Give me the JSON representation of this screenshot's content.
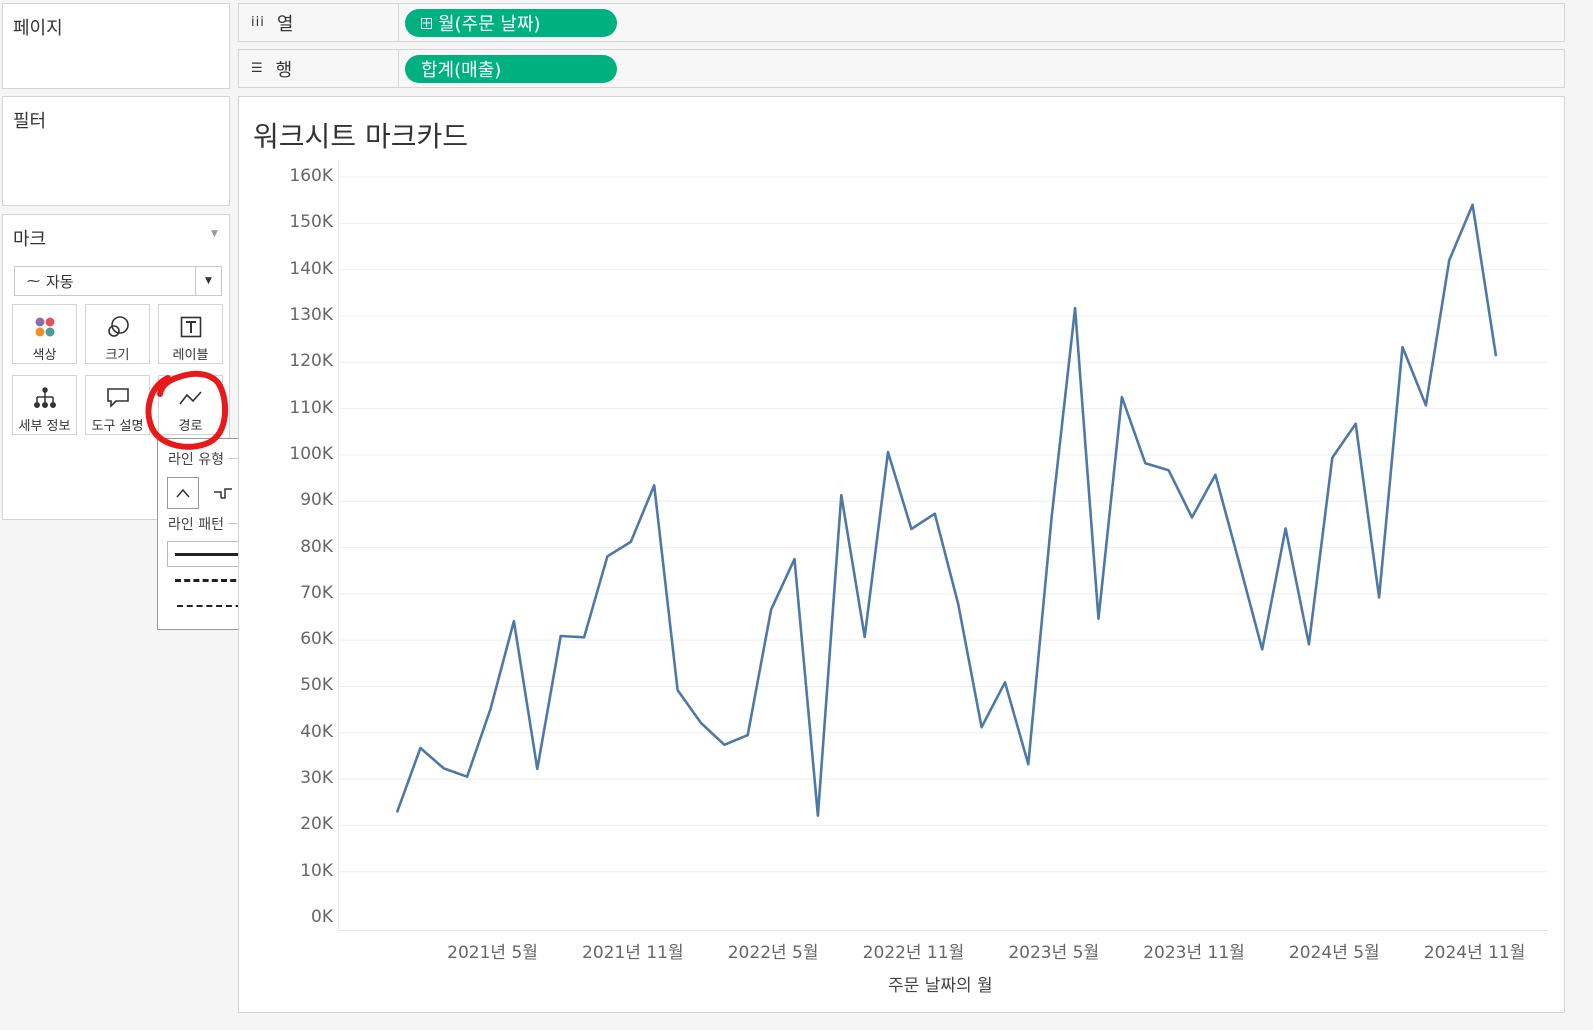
{
  "pages_card": {
    "title": "페이지"
  },
  "filters_card": {
    "title": "필터"
  },
  "marks_card": {
    "title": "마크",
    "mark_type": "자동",
    "buttons": [
      {
        "label": "색상",
        "icon": "color-dots-icon"
      },
      {
        "label": "크기",
        "icon": "size-icon"
      },
      {
        "label": "레이블",
        "icon": "label-icon"
      },
      {
        "label": "세부 정보",
        "icon": "detail-icon"
      },
      {
        "label": "도구 설명",
        "icon": "tooltip-icon"
      },
      {
        "label": "경로",
        "icon": "path-icon"
      }
    ]
  },
  "path_popup": {
    "line_type_label": "라인 유형",
    "line_pattern_label": "라인 패턴"
  },
  "annotation_color": "#e8191b",
  "shelves": {
    "columns": {
      "label": "열",
      "pill": "월(주문 날짜)"
    },
    "rows": {
      "label": "행",
      "pill": "합계(매출)"
    }
  },
  "pill_color": "#00b180",
  "worksheet": {
    "title": "워크시트 마크카드"
  },
  "chart_data": {
    "type": "line",
    "xlabel": "주문 날짜의 월",
    "ylabel": "",
    "ylim": [
      0,
      160000
    ],
    "line_color": "#4e79a7",
    "grid": true,
    "yticks": [
      "160K",
      "150K",
      "140K",
      "130K",
      "120K",
      "110K",
      "100K",
      "90K",
      "80K",
      "70K",
      "60K",
      "50K",
      "40K",
      "30K",
      "20K",
      "10K",
      "0K"
    ],
    "xticks": [
      "2021년 5월",
      "2021년 11월",
      "2022년 5월",
      "2022년 11월",
      "2023년 5월",
      "2023년 11월",
      "2024년 5월",
      "2024년 11월"
    ],
    "x": [
      "2021-01",
      "2021-02",
      "2021-03",
      "2021-04",
      "2021-05",
      "2021-06",
      "2021-07",
      "2021-08",
      "2021-09",
      "2021-10",
      "2021-11",
      "2021-12",
      "2022-01",
      "2022-02",
      "2022-03",
      "2022-04",
      "2022-05",
      "2022-06",
      "2022-07",
      "2022-08",
      "2022-09",
      "2022-10",
      "2022-11",
      "2022-12",
      "2023-01",
      "2023-02",
      "2023-03",
      "2023-04",
      "2023-05",
      "2023-06",
      "2023-07",
      "2023-08",
      "2023-09",
      "2023-10",
      "2023-11",
      "2023-12",
      "2024-01",
      "2024-02",
      "2024-03",
      "2024-04",
      "2024-05",
      "2024-06",
      "2024-07",
      "2024-08",
      "2024-09",
      "2024-10",
      "2024-11",
      "2024-12"
    ],
    "values": [
      22800,
      36700,
      32300,
      30500,
      45100,
      64100,
      32200,
      60900,
      60600,
      78100,
      81200,
      93400,
      49200,
      42100,
      37400,
      39500,
      66600,
      77500,
      22100,
      91300,
      60700,
      100600,
      84000,
      87300,
      67800,
      41200,
      50900,
      33200,
      86700,
      131700,
      64600,
      112500,
      98200,
      96700,
      86500,
      95700,
      77000,
      58000,
      84100,
      59100,
      99400,
      106700,
      69200,
      123300,
      110700,
      142000,
      154000,
      121300
    ]
  }
}
